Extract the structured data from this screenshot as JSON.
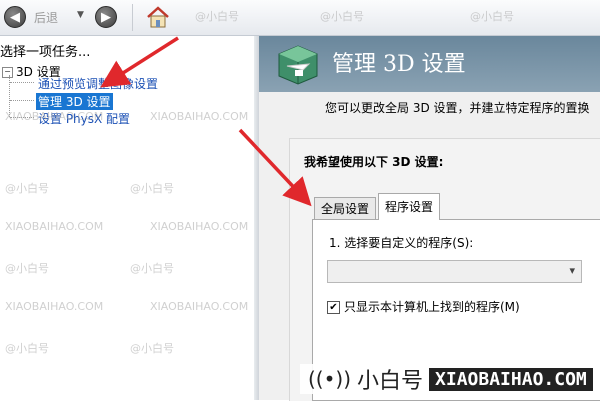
{
  "toolbar": {
    "back_label": "后退",
    "back_icon": "arrow-left-icon",
    "forward_icon": "arrow-right-icon",
    "home_icon": "home-icon"
  },
  "left_panel": {
    "task_label": "选择一项任务...",
    "tree": {
      "root_label": "3D 设置",
      "items": [
        {
          "label": "通过预览调整图像设置",
          "selected": false
        },
        {
          "label": "管理 3D 设置",
          "selected": true
        },
        {
          "label": "设置 PhysX 配置",
          "selected": false
        }
      ]
    }
  },
  "right_panel": {
    "title": "管理 3D 设置",
    "description": "您可以更改全局 3D 设置，并建立特定程序的置换",
    "preference_label": "我希望使用以下 3D 设置:",
    "tabs": [
      {
        "label": "全局设置",
        "active": false
      },
      {
        "label": "程序设置",
        "active": true
      }
    ],
    "select_program_label": "1. 选择要自定义的程序(S):",
    "program_select_value": "",
    "checkbox_label": "只显示本计算机上找到的程序(M)",
    "checkbox_checked": true
  },
  "watermark": {
    "text_handle": "@小白号",
    "text_domain": "XIAOBAIHAO.COM",
    "brand_cn": "小白号",
    "brand_en": "XIAOBAIHAO.COM"
  },
  "colors": {
    "header_bg": "#7a95a9",
    "selection": "#1976d2",
    "link": "#1a4fb4",
    "arrow": "#e0282c"
  }
}
